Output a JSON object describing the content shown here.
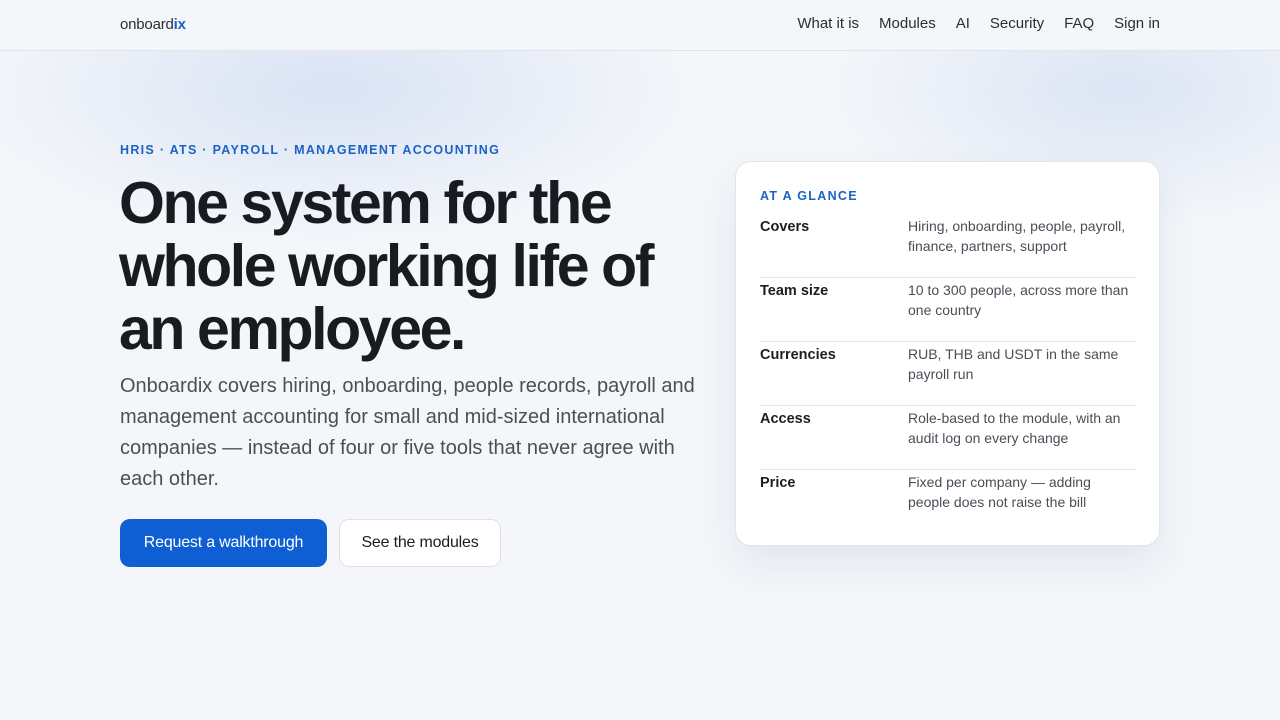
{
  "header": {
    "logo_main": "onboard",
    "logo_accent": "ix",
    "nav": [
      "What it is",
      "Modules",
      "AI",
      "Security",
      "FAQ",
      "Sign in"
    ]
  },
  "hero": {
    "eyebrow": "HRIS · ATS · PAYROLL · MANAGEMENT ACCOUNTING",
    "headline": "One system for the whole working life of an employee.",
    "lede": "Onboardix covers hiring, onboarding, people records, payroll and management accounting for small and mid-sized international companies — instead of four or five tools that never agree with each other.",
    "primary_cta": "Request a walkthrough",
    "secondary_cta": "See the modules"
  },
  "glance": {
    "title": "AT A GLANCE",
    "rows": [
      {
        "label": "Covers",
        "value": "Hiring, onboarding, people, payroll, finance, partners, support"
      },
      {
        "label": "Team size",
        "value": "10 to 300 people, across more than one country"
      },
      {
        "label": "Currencies",
        "value": "RUB, THB and USDT in the same payroll run"
      },
      {
        "label": "Access",
        "value": "Role-based to the module, with an audit log on every change"
      },
      {
        "label": "Price",
        "value": "Fixed per company — adding people does not raise the bill"
      }
    ]
  },
  "colors": {
    "accent": "#0e5fd3",
    "eyebrow": "#1b63c4",
    "background": "#f4f6fa"
  }
}
